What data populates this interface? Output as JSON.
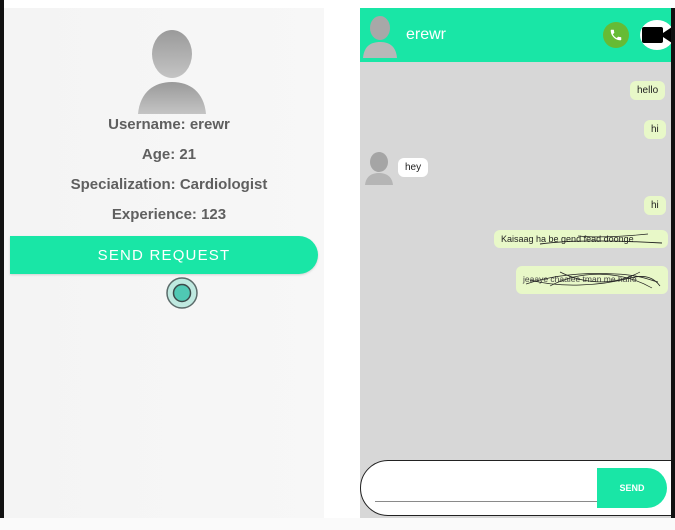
{
  "profile": {
    "username_line": "Username: erewr",
    "age_line": "Age: 21",
    "specialization_line": "Specialization: Cardiologist",
    "experience_line": "Experience: 123",
    "send_request_label": "SEND REQUEST"
  },
  "chat": {
    "contact_name": "erewr",
    "header_icons": [
      "avatar-icon",
      "phone-icon",
      "video-camera-icon"
    ],
    "messages": [
      {
        "direction": "out",
        "text": "hello"
      },
      {
        "direction": "out",
        "text": "hi"
      },
      {
        "direction": "in",
        "text": "hey"
      },
      {
        "direction": "out",
        "text": "hi"
      },
      {
        "direction": "out",
        "text": "Kaisaag ha be gend fead doonge"
      },
      {
        "direction": "out",
        "text": "jeaaye chaalee tman me haffe"
      }
    ],
    "composer_placeholder": "",
    "send_label": "SEND"
  },
  "colors": {
    "accent": "#19e6a6",
    "chat_bg": "#d7d7d7",
    "outgoing_bubble": "#e8f8c8",
    "incoming_bubble": "#ffffff",
    "call_green": "#66bb35"
  }
}
